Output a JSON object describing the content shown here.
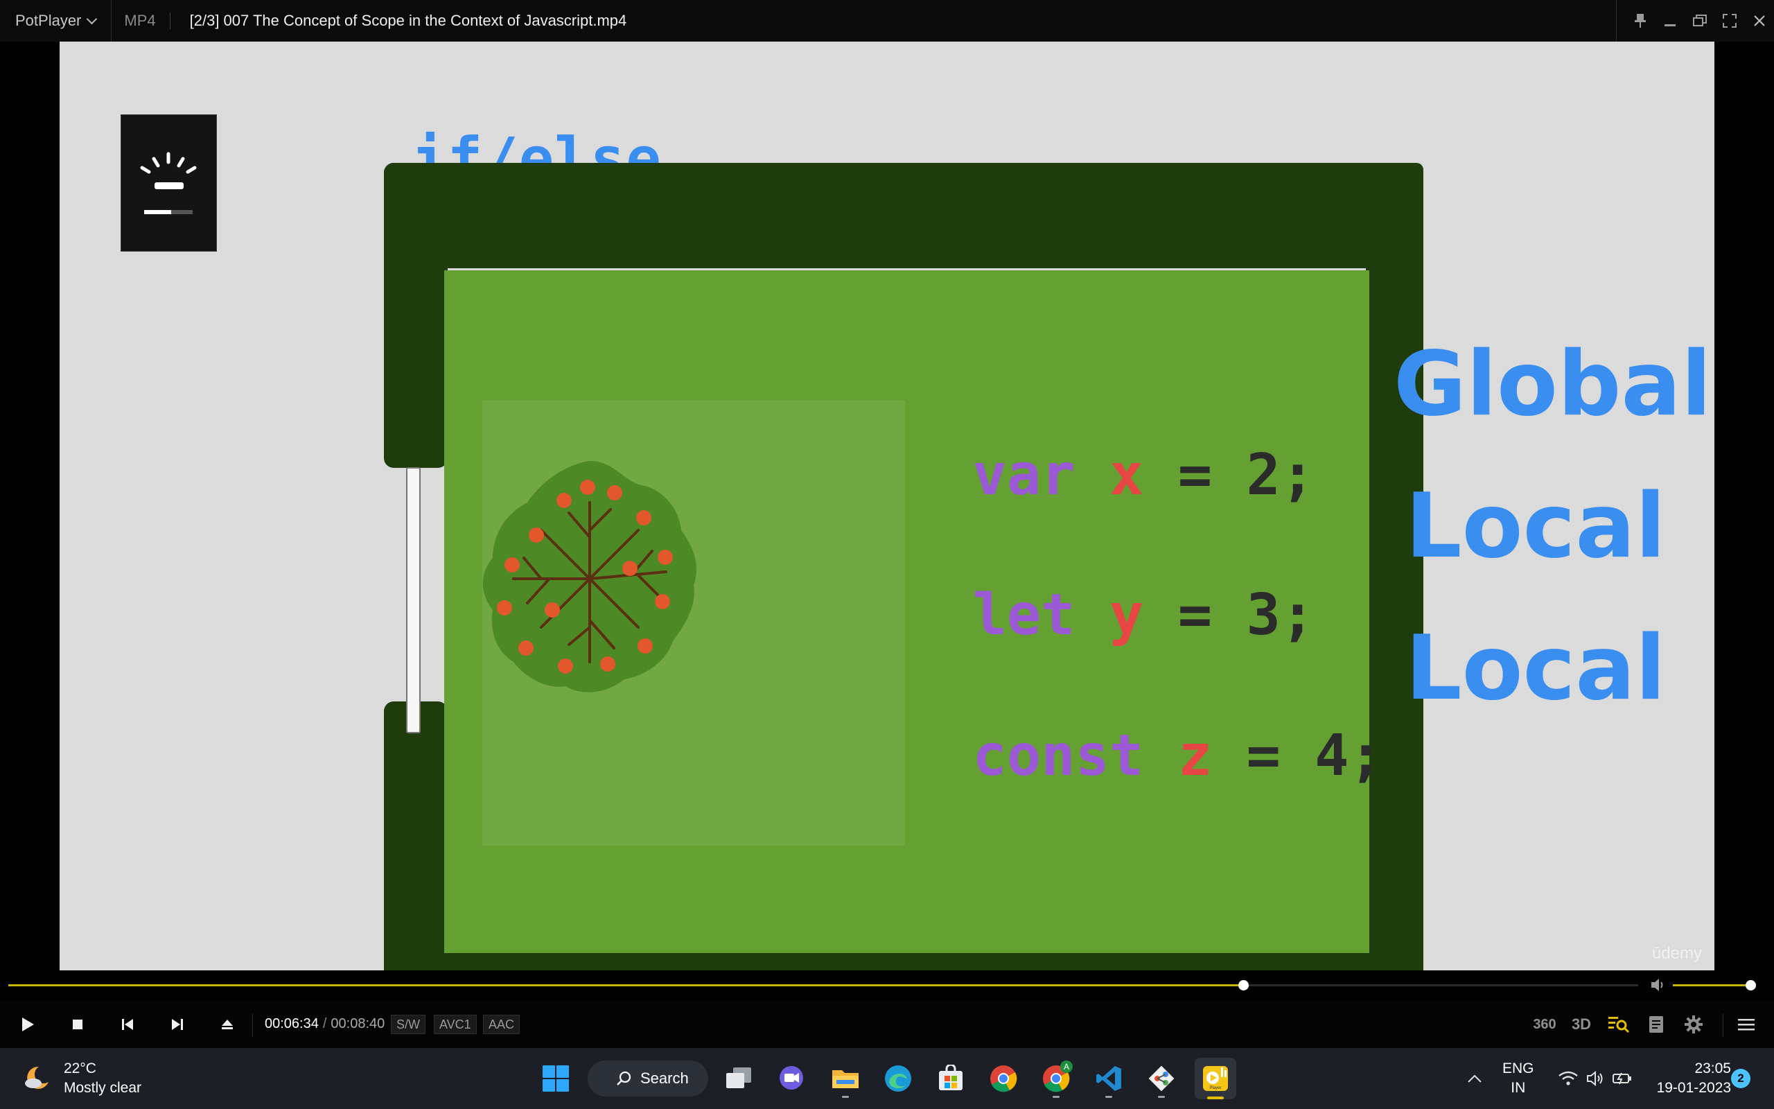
{
  "titlebar": {
    "app_name": "PotPlayer",
    "format": "MP4",
    "file_title": "[2/3] 007 The Concept of Scope in the Context of Javascript.mp4"
  },
  "video": {
    "scope_label": "if/else",
    "code_lines": [
      {
        "keyword": "var",
        "identifier": "x",
        "rest": " = 2;"
      },
      {
        "keyword": "let",
        "identifier": "y",
        "rest": " = 3;"
      },
      {
        "keyword": "const",
        "identifier": "z",
        "rest": " = 4;"
      }
    ],
    "scope_words": [
      "Global",
      "Local",
      "Local"
    ],
    "watermark": "ūdemy",
    "osd_brightness_level": 0.55
  },
  "playback": {
    "progress": 0.7577,
    "volume": 1.0,
    "current_time": "00:06:34",
    "total_time": "00:08:40",
    "decoder_badge": "S/W",
    "video_codec": "AVC1",
    "audio_codec": "AAC",
    "right_buttons": [
      "360",
      "3D"
    ]
  },
  "taskbar": {
    "weather_temp": "22°C",
    "weather_desc": "Mostly clear",
    "search_label": "Search",
    "lang_1": "ENG",
    "lang_2": "IN",
    "time": "23:05",
    "date": "19-01-2023",
    "notification_count": "2",
    "chrome_profile_badge": "A",
    "potplayer_icon_label": "Player"
  },
  "colors": {
    "accent_blue": "#3a8ef0",
    "keyword_purple": "#9b59d6",
    "identifier_red": "#e84545",
    "seek_yellow": "#c8b400",
    "hedge_green": "#1f3d0c",
    "lawn_green": "#64a032"
  }
}
